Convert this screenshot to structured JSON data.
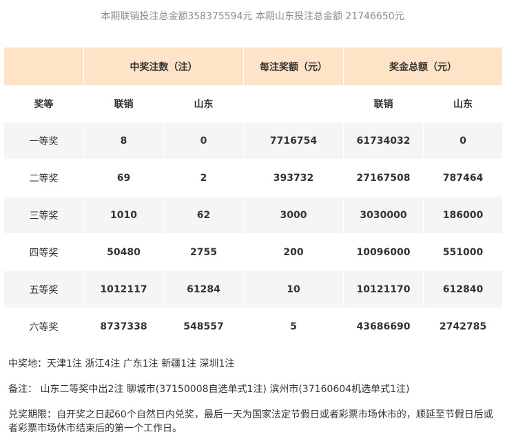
{
  "summary": "本期联销投注总金额358375594元 本期山东投注总金额 21746650元",
  "headers": {
    "winners": "中奖注数（注）",
    "per_bet": "每注奖额（元）",
    "total": "奖金总额（元）",
    "rank": "奖等",
    "lianxiao": "联销",
    "shandong": "山东",
    "total_lianxiao": "联销",
    "total_shandong": "山东"
  },
  "rows": [
    {
      "rank": "一等奖",
      "lianxiao": "8",
      "shandong": "0",
      "per_bet": "7716754",
      "total_lianxiao": "61734032",
      "total_shandong": "0"
    },
    {
      "rank": "二等奖",
      "lianxiao": "69",
      "shandong": "2",
      "per_bet": "393732",
      "total_lianxiao": "27167508",
      "total_shandong": "787464"
    },
    {
      "rank": "三等奖",
      "lianxiao": "1010",
      "shandong": "62",
      "per_bet": "3000",
      "total_lianxiao": "3030000",
      "total_shandong": "186000"
    },
    {
      "rank": "四等奖",
      "lianxiao": "50480",
      "shandong": "2755",
      "per_bet": "200",
      "total_lianxiao": "10096000",
      "total_shandong": "551000"
    },
    {
      "rank": "五等奖",
      "lianxiao": "1012117",
      "shandong": "61284",
      "per_bet": "10",
      "total_lianxiao": "10121170",
      "total_shandong": "612840"
    },
    {
      "rank": "六等奖",
      "lianxiao": "8737338",
      "shandong": "548557",
      "per_bet": "5",
      "total_lianxiao": "43686690",
      "total_shandong": "2742785"
    }
  ],
  "notes": {
    "locations": "中奖地：天津1注 浙江4注 广东1注 新疆1注 深圳1注",
    "remark": "备注： 山东二等奖中出2注 聊城市(37150008自选单式1注) 滨州市(37160604机选单式1注)",
    "deadline": "兑奖期限：自开奖之日起60个自然日内兑奖，最后一天为国家法定节假日或者彩票市场休市的，顺延至节假日后或者彩票市场休市结束后的第一个工作日。"
  },
  "colors": {
    "header_bg": "#ffe3c7",
    "row_alt_bg": "#f5f5f5",
    "summary_text": "#8c8c8c"
  }
}
